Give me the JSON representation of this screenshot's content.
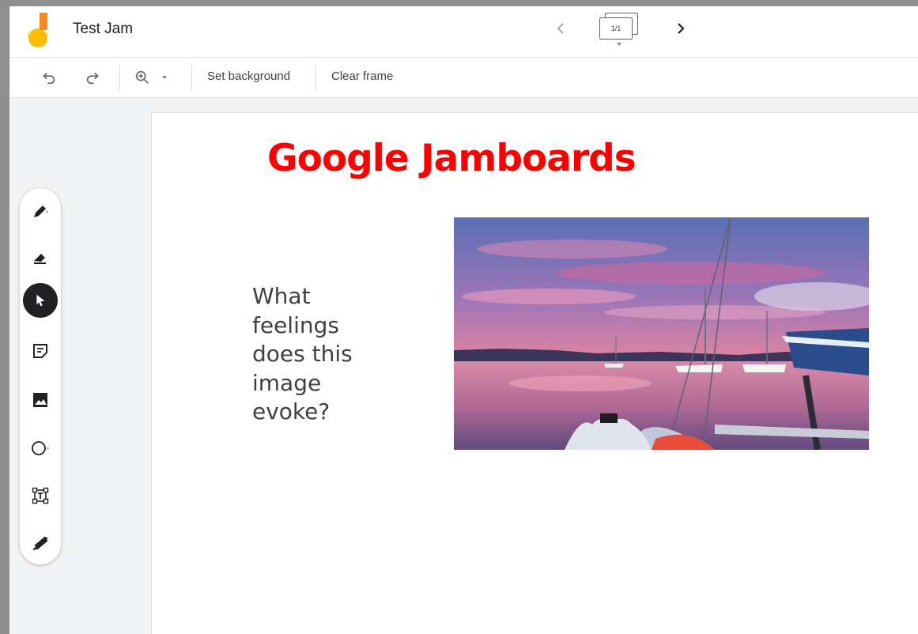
{
  "header": {
    "title": "Test Jam",
    "frame_indicator": "1/1",
    "prev_icon": "chevron-left-icon",
    "next_icon": "chevron-right-icon"
  },
  "toolbar": {
    "undo_icon": "undo-icon",
    "redo_icon": "redo-icon",
    "zoom_icon": "zoom-in-icon",
    "set_background_label": "Set background",
    "clear_frame_label": "Clear frame"
  },
  "tools": [
    "pen-tool",
    "eraser-tool",
    "select-tool",
    "sticky-note-tool",
    "add-image-tool",
    "shape-tool",
    "text-box-tool",
    "laser-tool"
  ],
  "active_tool": "select-tool",
  "canvas": {
    "title": "Google Jamboards",
    "title_color": "#ff0000",
    "prompt_lines": [
      "What",
      "feelings",
      "does this",
      "image",
      "evoke?"
    ],
    "image_subject": "sunset harbor with sailboats"
  },
  "colors": {
    "logo_orange": "#f28b20",
    "logo_yellow": "#fbbc04",
    "active_tool_bg": "#202124"
  }
}
